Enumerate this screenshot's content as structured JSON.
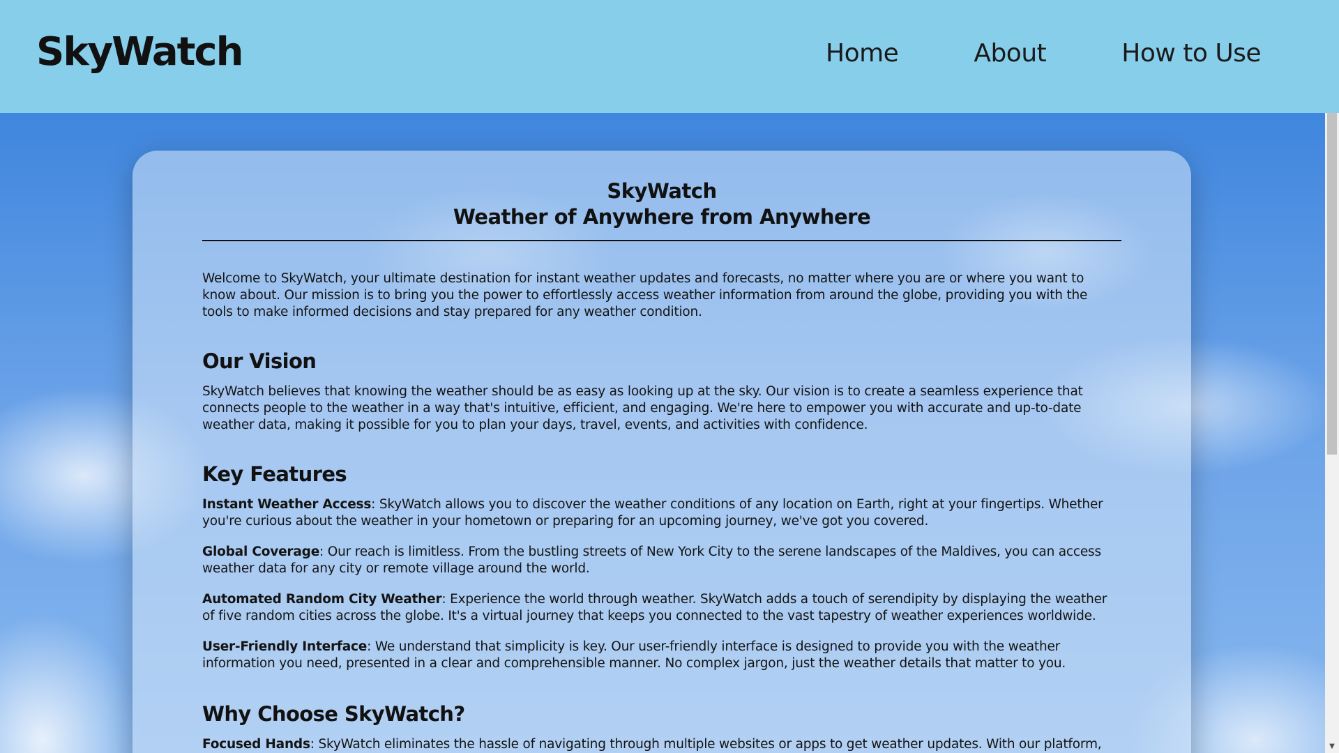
{
  "header": {
    "logo": "SkyWatch",
    "nav": [
      "Home",
      "About",
      "How to Use"
    ]
  },
  "card": {
    "title_line1": "SkyWatch",
    "title_line2": "Weather of Anywhere from Anywhere",
    "intro": "Welcome to SkyWatch, your ultimate destination for instant weather updates and forecasts, no matter where you are or where you want to know about. Our mission is to bring you the power to effortlessly access weather information from around the globe, providing you with the tools to make informed decisions and stay prepared for any weather condition.",
    "vision": {
      "heading": "Our Vision",
      "text": "SkyWatch believes that knowing the weather should be as easy as looking up at the sky. Our vision is to create a seamless experience that connects people to the weather in a way that's intuitive, efficient, and engaging. We're here to empower you with accurate and up-to-date weather data, making it possible for you to plan your days, travel, events, and activities with confidence."
    },
    "features": {
      "heading": "Key Features",
      "items": [
        {
          "term": "Instant Weather Access",
          "text": ": SkyWatch allows you to discover the weather conditions of any location on Earth, right at your fingertips. Whether you're curious about the weather in your hometown or preparing for an upcoming journey, we've got you covered."
        },
        {
          "term": "Global Coverage",
          "text": ": Our reach is limitless. From the bustling streets of New York City to the serene landscapes of the Maldives, you can access weather data for any city or remote village around the world."
        },
        {
          "term": "Automated Random City Weather",
          "text": ": Experience the world through weather. SkyWatch adds a touch of serendipity by displaying the weather of five random cities across the globe. It's a virtual journey that keeps you connected to the vast tapestry of weather experiences worldwide."
        },
        {
          "term": "User-Friendly Interface",
          "text": ": We understand that simplicity is key. Our user-friendly interface is designed to provide you with the weather information you need, presented in a clear and comprehensible manner. No complex jargon, just the weather details that matter to you."
        }
      ]
    },
    "why": {
      "heading": "Why Choose SkyWatch?",
      "first_term": "Focused Hands",
      "first_text": ": SkyWatch eliminates the hassle of navigating through multiple websites or apps to get weather updates. With our platform, weather"
    }
  }
}
